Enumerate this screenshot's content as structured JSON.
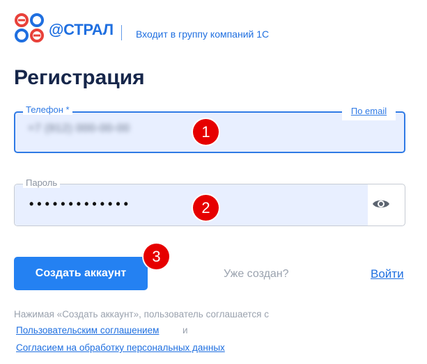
{
  "header": {
    "brand": "@СТРАЛ",
    "group_text": "Входит в группу компаний 1С"
  },
  "page_title": "Регистрация",
  "phone": {
    "label": "Телефон *",
    "value": "+7 (912) 000-00-00",
    "switch_link": "По email"
  },
  "password": {
    "label": "Пароль",
    "value": "•••••••••••••",
    "show_icon": "eye-icon"
  },
  "markers": [
    "1",
    "2",
    "3"
  ],
  "actions": {
    "create_button": "Создать аккаунт",
    "already_text": "Уже создан?",
    "login_link": "Войти"
  },
  "legal": {
    "text": "Нажимая «Создать аккаунт», пользователь соглашается с",
    "agreement_link": "Пользовательским соглашением",
    "and_text": "и",
    "consent_link": "Согласием на обработку персональных данных"
  },
  "colors": {
    "accent": "#2481f2",
    "brand_blue": "#1f6fe0",
    "logo_red": "#e8413a",
    "marker_red": "#e60000",
    "field_fill": "#e8efff"
  }
}
